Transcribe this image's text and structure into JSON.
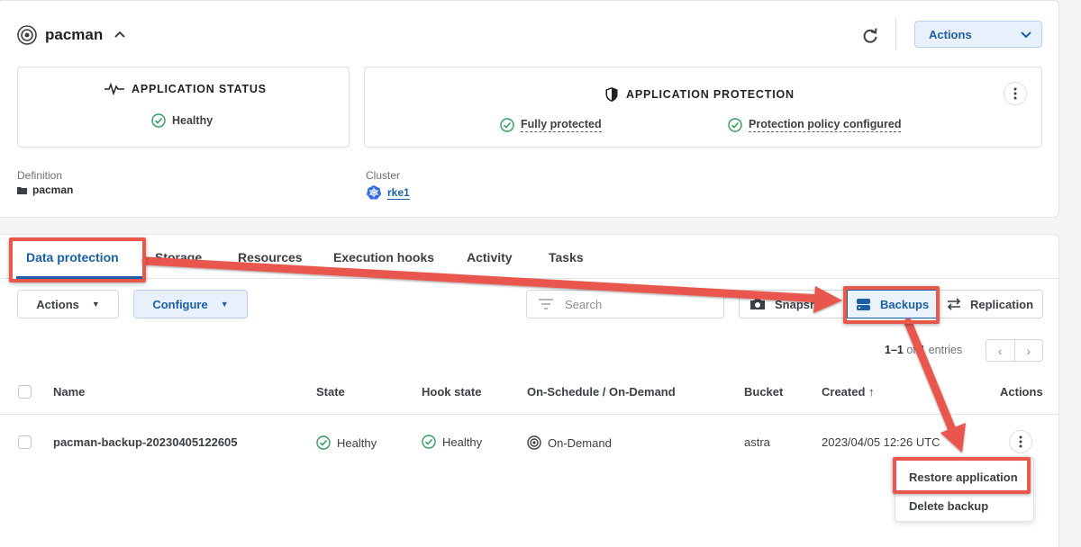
{
  "app": {
    "name": "pacman",
    "actions_label": "Actions"
  },
  "application_status": {
    "title": "APPLICATION STATUS",
    "status": "Healthy"
  },
  "application_protection": {
    "title": "APPLICATION PROTECTION",
    "protection_state": "Fully protected",
    "policy_state": "Protection policy configured"
  },
  "details": {
    "definition_label": "Definition",
    "definition_value": "pacman",
    "cluster_label": "Cluster",
    "cluster_value": "rke1"
  },
  "tabs": [
    {
      "label": "Data protection",
      "active": true
    },
    {
      "label": "Storage"
    },
    {
      "label": "Resources"
    },
    {
      "label": "Execution hooks"
    },
    {
      "label": "Activity"
    },
    {
      "label": "Tasks"
    }
  ],
  "toolbar": {
    "actions_label": "Actions",
    "configure_label": "Configure",
    "search_placeholder": "Search",
    "snapshots_label": "Snapshots",
    "backups_label": "Backups",
    "replication_label": "Replication"
  },
  "pagination": {
    "range": "1–1",
    "of_word": "of",
    "total": "1",
    "suffix": "entries"
  },
  "table": {
    "columns": [
      "Name",
      "State",
      "Hook state",
      "On-Schedule / On-Demand",
      "Bucket",
      "Created ↑",
      "Actions"
    ],
    "rows": [
      {
        "name": "pacman-backup-20230405122605",
        "state": "Healthy",
        "hook_state": "Healthy",
        "schedule": "On-Demand",
        "bucket": "astra",
        "created": "2023/04/05 12:26 UTC"
      }
    ]
  },
  "row_menu": {
    "items": [
      "Restore application",
      "Delete backup"
    ]
  },
  "colors": {
    "accent": "#1a5fa8",
    "success": "#2e9e5b",
    "annotation": "#e9574d"
  }
}
